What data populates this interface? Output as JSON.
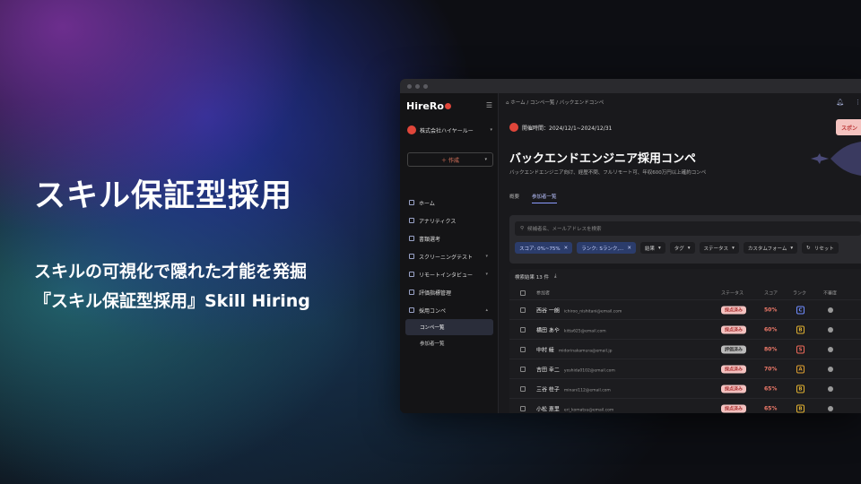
{
  "hero": {
    "title": "スキル保証型採用",
    "tagline1": "スキルの可視化で隠れた才能を発掘",
    "tagline2": "『スキル保証型採用』Skill Hiring"
  },
  "app": {
    "logo": "HireRo",
    "company": "株式会社ハイヤールー",
    "create_label": "＋ 作成",
    "nav": [
      {
        "label": "ホーム",
        "icon": "home-icon"
      },
      {
        "label": "アナリティクス",
        "icon": "analytics-icon"
      },
      {
        "label": "書類選考",
        "icon": "document-icon"
      },
      {
        "label": "スクリーニングテスト",
        "icon": "screen-icon"
      },
      {
        "label": "リモートインタビュー",
        "icon": "video-icon"
      },
      {
        "label": "評価指標管理",
        "icon": "evaluation-icon"
      },
      {
        "label": "採用コンペ",
        "icon": "competition-icon"
      }
    ],
    "nav_sub": [
      "コンペ一覧",
      "参加者一覧"
    ],
    "breadcrumb": "⌂ ホーム / コンペ一覧 / バックエンドコンペ",
    "period": "開催時間：2024/12/1~2024/12/31",
    "sponsor_label": "スポン",
    "page_title": "バックエンドエンジニア採用コンペ",
    "page_desc": "バックエンドエンジニア向け、経歴不問、フルリモート可、年収600万円以上確約コンペ",
    "tabs": [
      "概要",
      "参加者一覧"
    ],
    "search_placeholder": "候補者名、メールアドレスを検索",
    "chips_selected": [
      "スコア: 0%~75%",
      "ランク: Sランク,..."
    ],
    "chips_plain": [
      "結果",
      "タグ",
      "ステータス",
      "カスタムフォーム",
      "リセット"
    ],
    "result_count": "検索結果 13 件",
    "columns": [
      "参加者",
      "ステータス",
      "スコア",
      "ランク",
      "不審度"
    ],
    "rows": [
      {
        "name": "西谷 一朗",
        "email": "ichiroo_nishitani@email.com",
        "status": "採点済み",
        "score": "50%",
        "rank": "C",
        "rank_color": "#6f8cff"
      },
      {
        "name": "横田 あや",
        "email": "kitta625@email.com",
        "status": "採点済み",
        "score": "60%",
        "rank": "B",
        "rank_color": "#e0b030"
      },
      {
        "name": "中村 綾",
        "email": "midorinakamura@email.jp",
        "status": "評価済み",
        "score": "80%",
        "rank": "S",
        "rank_color": "#ef6a5a"
      },
      {
        "name": "吉田 幸二",
        "email": "yoshida0102@email.com",
        "status": "採点済み",
        "score": "70%",
        "rank": "A",
        "rank_color": "#e0a030"
      },
      {
        "name": "三谷 桂子",
        "email": "minani112@email.com",
        "status": "採点済み",
        "score": "65%",
        "rank": "B",
        "rank_color": "#e0b030"
      },
      {
        "name": "小松 恵里",
        "email": "eri_komatsu@email.com",
        "status": "採点済み",
        "score": "65%",
        "rank": "B",
        "rank_color": "#e0b030"
      }
    ]
  },
  "colors": {
    "accent": "#e0463a",
    "selected_chip": "#2b3c6b",
    "status_bg": "#f3c2c0"
  }
}
